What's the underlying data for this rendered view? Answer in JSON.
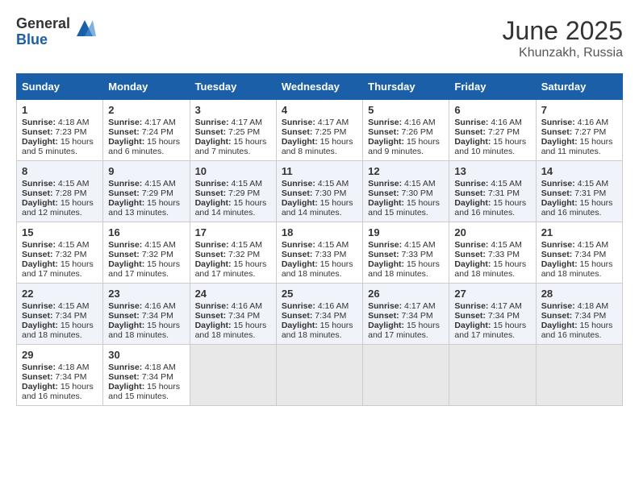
{
  "logo": {
    "general": "General",
    "blue": "Blue"
  },
  "title": "June 2025",
  "location": "Khunzakh, Russia",
  "headers": [
    "Sunday",
    "Monday",
    "Tuesday",
    "Wednesday",
    "Thursday",
    "Friday",
    "Saturday"
  ],
  "weeks": [
    [
      {
        "day": "1",
        "sunrise": "4:18 AM",
        "sunset": "7:23 PM",
        "daylight": "15 hours and 5 minutes."
      },
      {
        "day": "2",
        "sunrise": "4:17 AM",
        "sunset": "7:24 PM",
        "daylight": "15 hours and 6 minutes."
      },
      {
        "day": "3",
        "sunrise": "4:17 AM",
        "sunset": "7:25 PM",
        "daylight": "15 hours and 7 minutes."
      },
      {
        "day": "4",
        "sunrise": "4:17 AM",
        "sunset": "7:25 PM",
        "daylight": "15 hours and 8 minutes."
      },
      {
        "day": "5",
        "sunrise": "4:16 AM",
        "sunset": "7:26 PM",
        "daylight": "15 hours and 9 minutes."
      },
      {
        "day": "6",
        "sunrise": "4:16 AM",
        "sunset": "7:27 PM",
        "daylight": "15 hours and 10 minutes."
      },
      {
        "day": "7",
        "sunrise": "4:16 AM",
        "sunset": "7:27 PM",
        "daylight": "15 hours and 11 minutes."
      }
    ],
    [
      {
        "day": "8",
        "sunrise": "4:15 AM",
        "sunset": "7:28 PM",
        "daylight": "15 hours and 12 minutes."
      },
      {
        "day": "9",
        "sunrise": "4:15 AM",
        "sunset": "7:29 PM",
        "daylight": "15 hours and 13 minutes."
      },
      {
        "day": "10",
        "sunrise": "4:15 AM",
        "sunset": "7:29 PM",
        "daylight": "15 hours and 14 minutes."
      },
      {
        "day": "11",
        "sunrise": "4:15 AM",
        "sunset": "7:30 PM",
        "daylight": "15 hours and 14 minutes."
      },
      {
        "day": "12",
        "sunrise": "4:15 AM",
        "sunset": "7:30 PM",
        "daylight": "15 hours and 15 minutes."
      },
      {
        "day": "13",
        "sunrise": "4:15 AM",
        "sunset": "7:31 PM",
        "daylight": "15 hours and 16 minutes."
      },
      {
        "day": "14",
        "sunrise": "4:15 AM",
        "sunset": "7:31 PM",
        "daylight": "15 hours and 16 minutes."
      }
    ],
    [
      {
        "day": "15",
        "sunrise": "4:15 AM",
        "sunset": "7:32 PM",
        "daylight": "15 hours and 17 minutes."
      },
      {
        "day": "16",
        "sunrise": "4:15 AM",
        "sunset": "7:32 PM",
        "daylight": "15 hours and 17 minutes."
      },
      {
        "day": "17",
        "sunrise": "4:15 AM",
        "sunset": "7:32 PM",
        "daylight": "15 hours and 17 minutes."
      },
      {
        "day": "18",
        "sunrise": "4:15 AM",
        "sunset": "7:33 PM",
        "daylight": "15 hours and 18 minutes."
      },
      {
        "day": "19",
        "sunrise": "4:15 AM",
        "sunset": "7:33 PM",
        "daylight": "15 hours and 18 minutes."
      },
      {
        "day": "20",
        "sunrise": "4:15 AM",
        "sunset": "7:33 PM",
        "daylight": "15 hours and 18 minutes."
      },
      {
        "day": "21",
        "sunrise": "4:15 AM",
        "sunset": "7:34 PM",
        "daylight": "15 hours and 18 minutes."
      }
    ],
    [
      {
        "day": "22",
        "sunrise": "4:15 AM",
        "sunset": "7:34 PM",
        "daylight": "15 hours and 18 minutes."
      },
      {
        "day": "23",
        "sunrise": "4:16 AM",
        "sunset": "7:34 PM",
        "daylight": "15 hours and 18 minutes."
      },
      {
        "day": "24",
        "sunrise": "4:16 AM",
        "sunset": "7:34 PM",
        "daylight": "15 hours and 18 minutes."
      },
      {
        "day": "25",
        "sunrise": "4:16 AM",
        "sunset": "7:34 PM",
        "daylight": "15 hours and 18 minutes."
      },
      {
        "day": "26",
        "sunrise": "4:17 AM",
        "sunset": "7:34 PM",
        "daylight": "15 hours and 17 minutes."
      },
      {
        "day": "27",
        "sunrise": "4:17 AM",
        "sunset": "7:34 PM",
        "daylight": "15 hours and 17 minutes."
      },
      {
        "day": "28",
        "sunrise": "4:18 AM",
        "sunset": "7:34 PM",
        "daylight": "15 hours and 16 minutes."
      }
    ],
    [
      {
        "day": "29",
        "sunrise": "4:18 AM",
        "sunset": "7:34 PM",
        "daylight": "15 hours and 16 minutes."
      },
      {
        "day": "30",
        "sunrise": "4:18 AM",
        "sunset": "7:34 PM",
        "daylight": "15 hours and 15 minutes."
      },
      null,
      null,
      null,
      null,
      null
    ]
  ],
  "labels": {
    "sunrise": "Sunrise:",
    "sunset": "Sunset:",
    "daylight": "Daylight:"
  }
}
